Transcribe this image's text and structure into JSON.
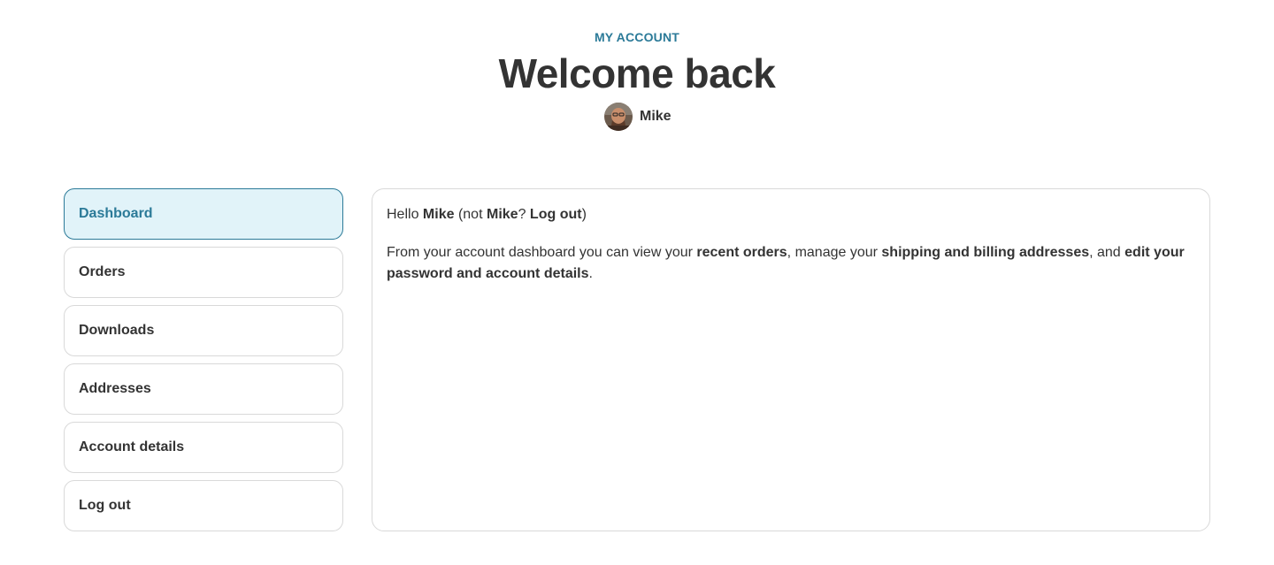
{
  "header": {
    "eyebrow": "MY ACCOUNT",
    "title": "Welcome back",
    "user_name": "Mike"
  },
  "sidebar": {
    "items": [
      {
        "label": "Dashboard",
        "active": true
      },
      {
        "label": "Orders",
        "active": false
      },
      {
        "label": "Downloads",
        "active": false
      },
      {
        "label": "Addresses",
        "active": false
      },
      {
        "label": "Account details",
        "active": false
      },
      {
        "label": "Log out",
        "active": false
      }
    ]
  },
  "content": {
    "greeting": {
      "hello": "Hello",
      "name": "Mike",
      "not_prefix": "(not",
      "not_name": "Mike",
      "question": "?",
      "logout_link": "Log out",
      "close_paren": ")"
    },
    "intro": {
      "part1": "From your account dashboard you can view your",
      "recent_orders": "recent orders",
      "part2": ", manage your",
      "addresses": "shipping and billing addresses",
      "part3": ", and",
      "edit_details": "edit your password and account details",
      "part4": "."
    }
  },
  "colors": {
    "accent": "#2b7a98",
    "active_bg": "#e1f3f9",
    "text": "#333333",
    "border": "#d9d9d9"
  }
}
